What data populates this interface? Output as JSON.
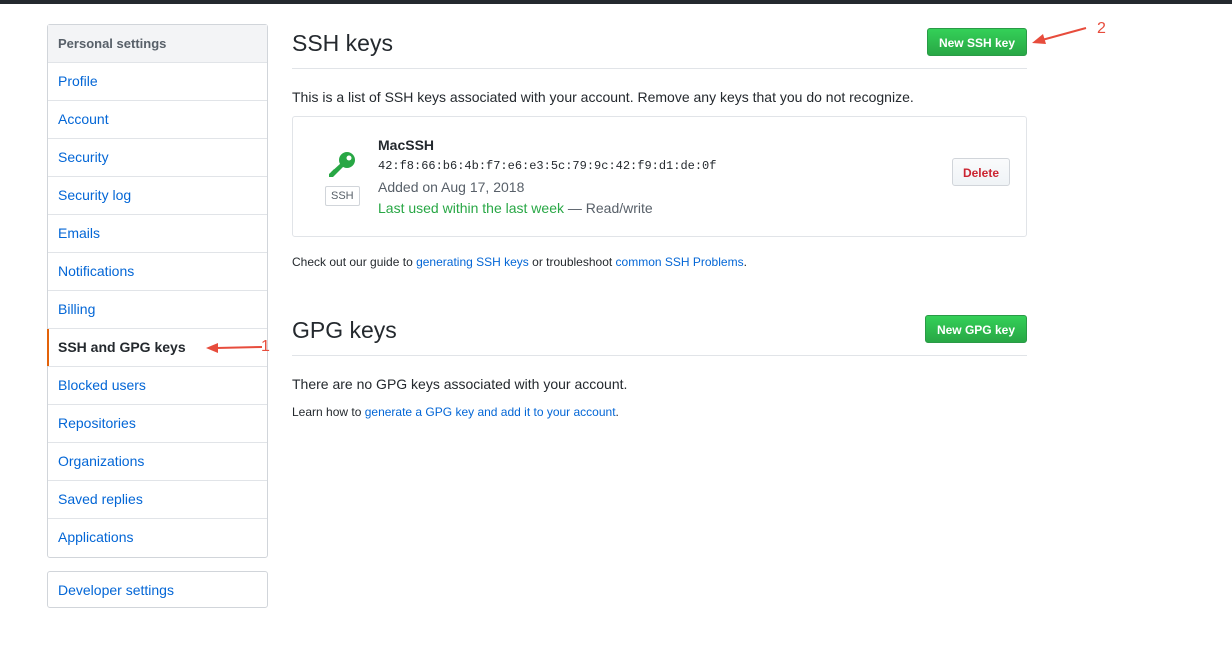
{
  "sidebar": {
    "header": "Personal settings",
    "items": [
      {
        "label": "Profile"
      },
      {
        "label": "Account"
      },
      {
        "label": "Security"
      },
      {
        "label": "Security log"
      },
      {
        "label": "Emails"
      },
      {
        "label": "Notifications"
      },
      {
        "label": "Billing"
      },
      {
        "label": "SSH and GPG keys",
        "selected": true
      },
      {
        "label": "Blocked users"
      },
      {
        "label": "Repositories"
      },
      {
        "label": "Organizations"
      },
      {
        "label": "Saved replies"
      },
      {
        "label": "Applications"
      }
    ],
    "developer_settings": "Developer settings"
  },
  "ssh": {
    "title": "SSH keys",
    "new_button": "New SSH key",
    "description": "This is a list of SSH keys associated with your account. Remove any keys that you do not recognize.",
    "key": {
      "badge": "SSH",
      "title": "MacSSH",
      "fingerprint": "42:f8:66:b6:4b:f7:e6:e3:5c:79:9c:42:f9:d1:de:0f",
      "added": "Added on Aug 17, 2018",
      "last_used": "Last used within the last week",
      "access": " — Read/write",
      "delete_label": "Delete"
    },
    "guide": {
      "prefix": "Check out our guide to ",
      "link1": "generating SSH keys",
      "middle": " or troubleshoot ",
      "link2": "common SSH Problems",
      "suffix": "."
    }
  },
  "gpg": {
    "title": "GPG keys",
    "new_button": "New GPG key",
    "empty": "There are no GPG keys associated with your account.",
    "learn": {
      "prefix": "Learn how to ",
      "link": "generate a GPG key and add it to your account",
      "suffix": "."
    }
  },
  "annotations": {
    "one": "1",
    "two": "2",
    "color": "#e74c3c"
  },
  "colors": {
    "link": "#0366d6",
    "green": "#28a745",
    "selected_border": "#e36209",
    "danger": "#cb2431"
  }
}
